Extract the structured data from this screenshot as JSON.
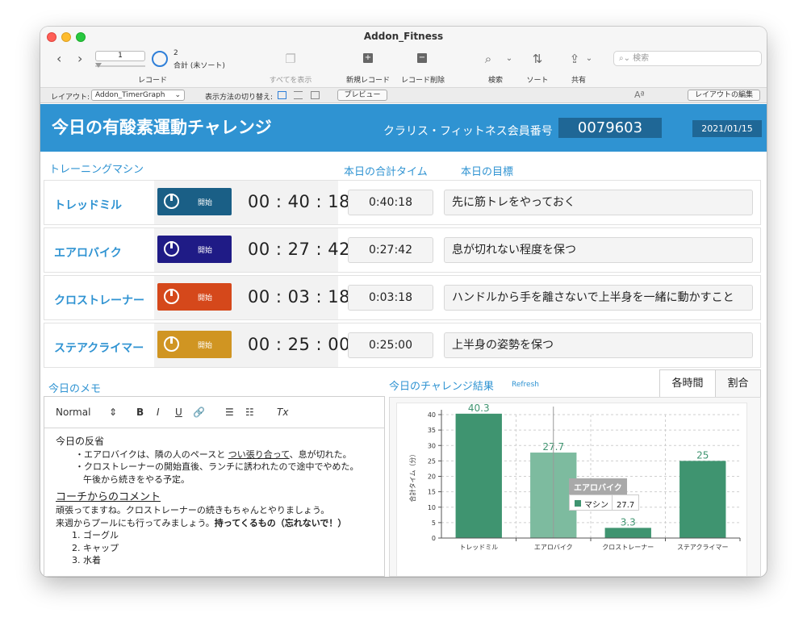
{
  "window": {
    "title": "Addon_Fitness"
  },
  "toolbar": {
    "record_value": "1",
    "record_count": "2",
    "record_total": "合計 (未ソート)",
    "records_label": "レコード",
    "show_all": "すべてを表示",
    "new_record": "新規レコード",
    "delete_record": "レコード削除",
    "find": "検索",
    "sort": "ソート",
    "share": "共有",
    "search_placeholder": "検索"
  },
  "layoutbar": {
    "layout_label": "レイアウト:",
    "layout_value": "Addon_TimerGraph",
    "view_as_label": "表示方法の切り替え:",
    "preview": "プレビュー",
    "edit_layout": "レイアウトの編集",
    "text_icon": "Aª"
  },
  "header": {
    "title": "今日の有酸素運動チャレンジ",
    "member_label": "クラリス・フィットネス会員番号",
    "member_number": "0079603",
    "date": "2021/01/15"
  },
  "labels": {
    "machines": "トレーニングマシン",
    "total_time": "本日の合計タイム",
    "goal": "本日の目標",
    "memo": "今日のメモ",
    "results": "今日のチャレンジ結果",
    "refresh": "Refresh"
  },
  "machines": [
    {
      "name": "トレッドミル",
      "start": "開始",
      "timer": "00 : 40 : 18",
      "total": "0:40:18",
      "goal": "先に筋トレをやっておく",
      "color": "#1a5f86"
    },
    {
      "name": "エアロバイク",
      "start": "開始",
      "timer": "00 : 27 : 42",
      "total": "0:27:42",
      "goal": "息が切れない程度を保つ",
      "color": "#1f1b86"
    },
    {
      "name": "クロストレーナー",
      "start": "開始",
      "timer": "00 : 03 : 18",
      "total": "0:03:18",
      "goal": "ハンドルから手を離さないで上半身を一緒に動かすこと",
      "color": "#d5481b"
    },
    {
      "name": "ステアクライマー",
      "start": "開始",
      "timer": "00 : 25 : 00",
      "total": "0:25:00",
      "goal": "上半身の姿勢を保つ",
      "color": "#d09522"
    }
  ],
  "memo": {
    "toolbar": {
      "style": "Normal",
      "bold": "B",
      "italic": "I",
      "underline": "U",
      "link": "🔗",
      "ordered_list": "☰",
      "bullet_list": "☷",
      "clear_format": "Tx"
    },
    "reflection_title": "今日の反省",
    "reflection_1a": "・エアロバイクは、隣の人のペースと ",
    "reflection_1b": "つい張り合って",
    "reflection_1c": "、息が切れた。",
    "reflection_2": "・クロストレーナーの開始直後、ランチに誘われたので途中でやめた。",
    "reflection_3": "午後から続きをやる予定。",
    "coach_title": "コーチからのコメント",
    "coach_1": "頑張ってますね。クロストレーナーの続きもちゃんとやりましょう。",
    "coach_2a": "来週からプールにも行ってみましょう。",
    "coach_2b": "持ってくるもの（忘れないで！）",
    "items": [
      "1. ゴーグル",
      "2. キャップ",
      "3. 水着"
    ]
  },
  "tabs": {
    "each_time": "各時間",
    "ratio": "割合"
  },
  "chart_data": {
    "type": "bar",
    "categories": [
      "トレッドミル",
      "エアロバイク",
      "クロストレーナー",
      "ステアクライマー"
    ],
    "series": [
      {
        "name": "マシン",
        "values": [
          40.3,
          27.7,
          3.3,
          25
        ]
      }
    ],
    "ylabel": "合計タイム（分）",
    "ylim": [
      0,
      40
    ],
    "yticks": [
      0,
      5,
      10,
      15,
      20,
      25,
      30,
      35,
      40
    ],
    "grid": true,
    "bar_color": "#3f9470",
    "highlight_color": "#7dbb9f",
    "tooltip": {
      "title": "エアロバイク",
      "series": "マシン",
      "value": "27.7"
    }
  }
}
